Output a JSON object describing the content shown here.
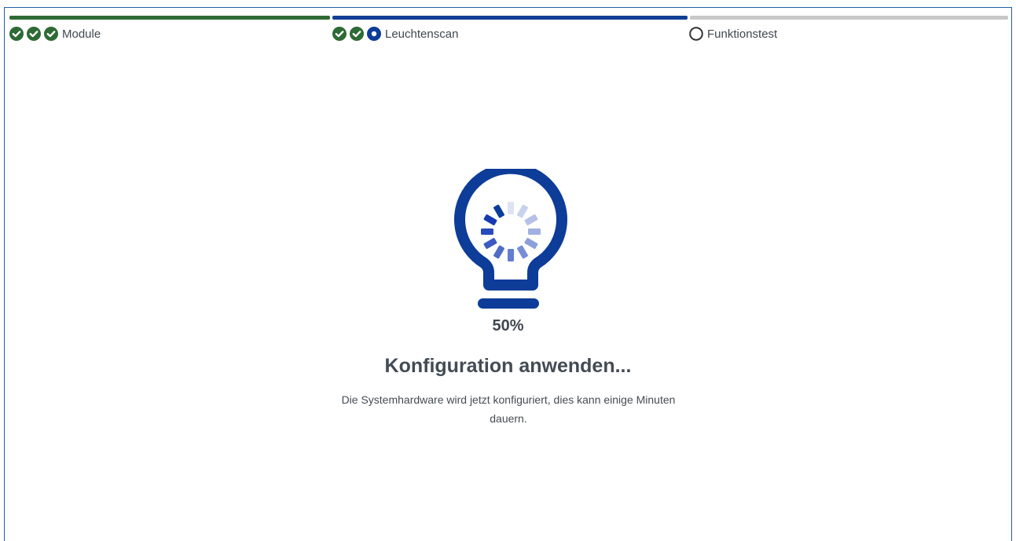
{
  "steps": [
    {
      "label": "Module",
      "progress": 1.0,
      "bar_color": "#2e6a35",
      "icons": [
        "check-circle-icon",
        "check-circle-icon",
        "check-circle-icon"
      ]
    },
    {
      "label": "Leuchtenscan",
      "progress": 1.0,
      "bar_color": "#113f94",
      "icons": [
        "check-circle-icon",
        "check-circle-icon",
        "active-dot-icon"
      ]
    },
    {
      "label": "Funktionstest",
      "progress": 0.0,
      "bar_color": "#c8c8c8",
      "icons": [
        "empty-circle-icon"
      ]
    }
  ],
  "colors": {
    "success": "#2e6a35",
    "brand": "#0d3c99",
    "inactive": "#c8c8c8",
    "text": "#434b55"
  },
  "main": {
    "icon": "lightbulb-spinner-icon",
    "progress_percent": 50,
    "progress_label": "50%",
    "title": "Konfiguration anwenden...",
    "description": "Die Systemhardware wird jetzt konfiguriert, dies kann einige Minuten dauern."
  }
}
